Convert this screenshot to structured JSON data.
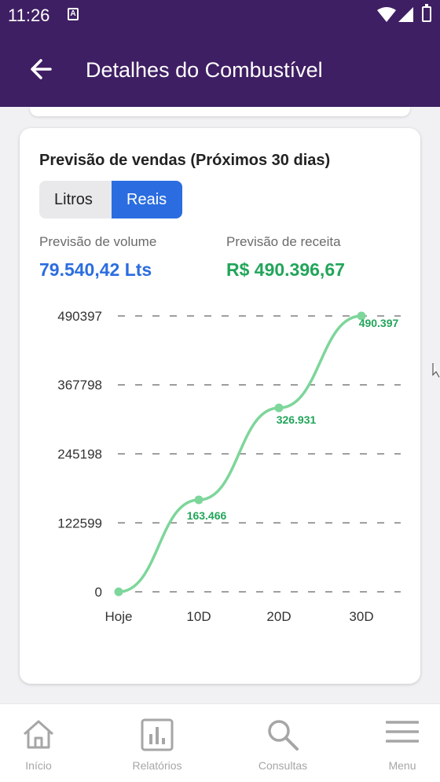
{
  "status_bar": {
    "time": "11:26",
    "notification_letter": "A"
  },
  "app_bar": {
    "title": "Detalhes do Combustível"
  },
  "forecast_card": {
    "title": "Previsão de vendas (Próximos 30 dias)",
    "toggle": {
      "option_liters": "Litros",
      "option_reais": "Reais",
      "selected": "Reais"
    },
    "volume": {
      "label": "Previsão de volume",
      "value": "79.540,42 Lts"
    },
    "revenue": {
      "label": "Previsão de receita",
      "value": "R$ 490.396,67"
    }
  },
  "chart_data": {
    "type": "line",
    "categories": [
      "Hoje",
      "10D",
      "20D",
      "30D"
    ],
    "values": [
      0,
      163466,
      326931,
      490397
    ],
    "data_labels": [
      "",
      "163.466",
      "326.931",
      "490.397"
    ],
    "y_ticks": [
      "0",
      "122599",
      "245198",
      "367798",
      "490397"
    ],
    "ylim": [
      0,
      490397
    ],
    "grid": "dashed horizontal",
    "line_color": "#7dd69a",
    "label_color": "#22a55a"
  },
  "bottom_nav": [
    {
      "label": "Início",
      "icon": "home-icon"
    },
    {
      "label": "Relatórios",
      "icon": "bar-chart-icon"
    },
    {
      "label": "Consultas",
      "icon": "search-icon"
    },
    {
      "label": "Menu",
      "icon": "menu-icon"
    }
  ],
  "colors": {
    "app_bar": "#3f1f63",
    "accent_blue": "#2b6de0",
    "accent_green": "#22a55a"
  }
}
